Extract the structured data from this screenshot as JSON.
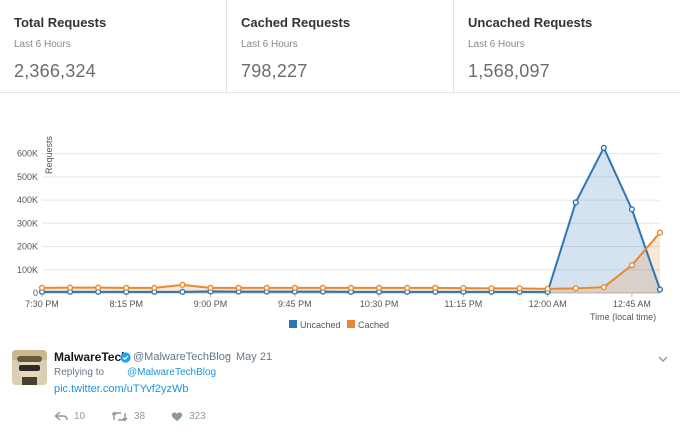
{
  "stats": [
    {
      "title": "Total Requests",
      "sub": "Last 6 Hours",
      "value": "2,366,324"
    },
    {
      "title": "Cached Requests",
      "sub": "Last 6 Hours",
      "value": "798,227"
    },
    {
      "title": "Uncached Requests",
      "sub": "Last 6 Hours",
      "value": "1,568,097"
    }
  ],
  "chart_data": {
    "type": "area",
    "ylabel": "Requests",
    "xlabel": "Time (local time)",
    "ylim": [
      0,
      650000
    ],
    "yticks": [
      "0",
      "100K",
      "200K",
      "300K",
      "400K",
      "500K",
      "600K"
    ],
    "xticks": [
      "7:30 PM",
      "8:15 PM",
      "9:00 PM",
      "9:45 PM",
      "10:30 PM",
      "11:15 PM",
      "12:00 AM",
      "12:45 AM"
    ],
    "x": [
      "7:30 PM",
      "7:45 PM",
      "8:00 PM",
      "8:15 PM",
      "8:30 PM",
      "8:45 PM",
      "9:00 PM",
      "9:15 PM",
      "9:30 PM",
      "9:45 PM",
      "10:00 PM",
      "10:15 PM",
      "10:30 PM",
      "10:45 PM",
      "11:00 PM",
      "11:15 PM",
      "11:30 PM",
      "11:45 PM",
      "12:00 AM",
      "12:15 AM",
      "12:30 AM",
      "12:45 AM",
      "1:00 AM"
    ],
    "series": [
      {
        "name": "Uncached",
        "color": "#2e75b6",
        "values": [
          5000,
          5000,
          5000,
          5000,
          5000,
          5000,
          7000,
          6000,
          6000,
          6000,
          6000,
          5000,
          5000,
          5000,
          5000,
          5000,
          5000,
          5000,
          5000,
          390000,
          625000,
          360000,
          15000
        ]
      },
      {
        "name": "Cached",
        "color": "#e8892f",
        "values": [
          22000,
          23000,
          23000,
          22000,
          22000,
          35000,
          22000,
          22000,
          22000,
          22000,
          22000,
          22000,
          22000,
          22000,
          22000,
          21000,
          20000,
          20000,
          18000,
          20000,
          25000,
          120000,
          260000
        ]
      }
    ],
    "legend_position": "bottom"
  },
  "tweet": {
    "name": "MalwareTech",
    "handle": "@MalwareTechBlog",
    "dot": "·",
    "date": "May 21",
    "reply_prefix": "Replying to",
    "reply_to": "@MalwareTechBlog",
    "link": "pic.twitter.com/uTYvf2yzWb",
    "replies": "10",
    "retweets": "38",
    "likes": "323"
  }
}
